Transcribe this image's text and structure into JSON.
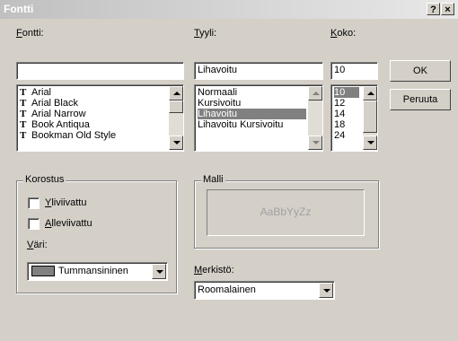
{
  "window": {
    "title": "Fontti",
    "help_label": "?",
    "close_label": "×"
  },
  "font": {
    "label_accel": "F",
    "label_rest": "ontti:",
    "value": "",
    "items": [
      "Arial",
      "Arial Black",
      "Arial Narrow",
      "Book Antiqua",
      "Bookman Old Style"
    ],
    "icon_glyph": "T"
  },
  "style": {
    "label_accel": "T",
    "label_rest": "yyli:",
    "value": "Lihavoitu",
    "items": [
      "Normaali",
      "Kursivoitu",
      "Lihavoitu",
      "Lihavoitu Kursivoitu"
    ],
    "selected_index": 2
  },
  "size": {
    "label_accel": "K",
    "label_rest": "oko:",
    "value": "10",
    "items": [
      "10",
      "12",
      "14",
      "18",
      "24"
    ],
    "selected_index": 0
  },
  "buttons": {
    "ok": "OK",
    "cancel": "Peruuta"
  },
  "effects": {
    "title": "Korostus",
    "strikeout_accel": "Y",
    "strikeout_rest": "liviivattu",
    "underline_accel": "A",
    "underline_rest": "lleviivattu",
    "color_label_accel": "V",
    "color_label_rest": "äri:",
    "color_value": "Tummansininen",
    "color_swatch": "#808080"
  },
  "sample": {
    "title": "Malli",
    "text": "AaBbYyZz"
  },
  "script": {
    "label_accel": "M",
    "label_rest": "erkistö:",
    "value": "Roomalainen"
  }
}
